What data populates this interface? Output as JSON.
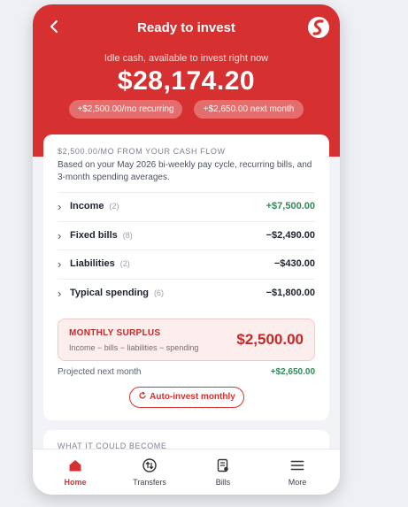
{
  "header": {
    "title": "Ready to invest",
    "subtitle": "Idle cash, available to invest right now",
    "amount": "$28,174.20",
    "chips": [
      "+$2,500.00/mo recurring",
      "+$2,650.00 next month"
    ]
  },
  "cashflow": {
    "kicker": "$2,500.00/MO FROM YOUR CASH FLOW",
    "description": "Based on your May 2026 bi-weekly pay cycle, recurring bills, and 3-month spending averages.",
    "rows": [
      {
        "label": "Income",
        "count": "(2)",
        "value": "+$7,500.00"
      },
      {
        "label": "Fixed bills",
        "count": "(8)",
        "value": "−$2,490.00"
      },
      {
        "label": "Liabilities",
        "count": "(2)",
        "value": "−$430.00"
      },
      {
        "label": "Typical spending",
        "count": "(6)",
        "value": "−$1,800.00"
      }
    ],
    "surplus": {
      "title": "MONTHLY SURPLUS",
      "subtitle": "Income − bills − liabilities − spending",
      "value": "$2,500.00"
    },
    "projected_label": "Projected next month",
    "projected_value": "+$2,650.00",
    "auto_invest_label": "Auto-invest monthly"
  },
  "next_card": {
    "kicker": "WHAT IT COULD BECOME"
  },
  "tabs": [
    {
      "label": "Home",
      "icon": "home-icon",
      "active": true
    },
    {
      "label": "Transfers",
      "icon": "transfers-icon",
      "active": false
    },
    {
      "label": "Bills",
      "icon": "bills-icon",
      "active": false
    },
    {
      "label": "More",
      "icon": "menu-icon",
      "active": false
    }
  ],
  "colors": {
    "brand": "#d63031",
    "positive": "#2e8b57"
  }
}
